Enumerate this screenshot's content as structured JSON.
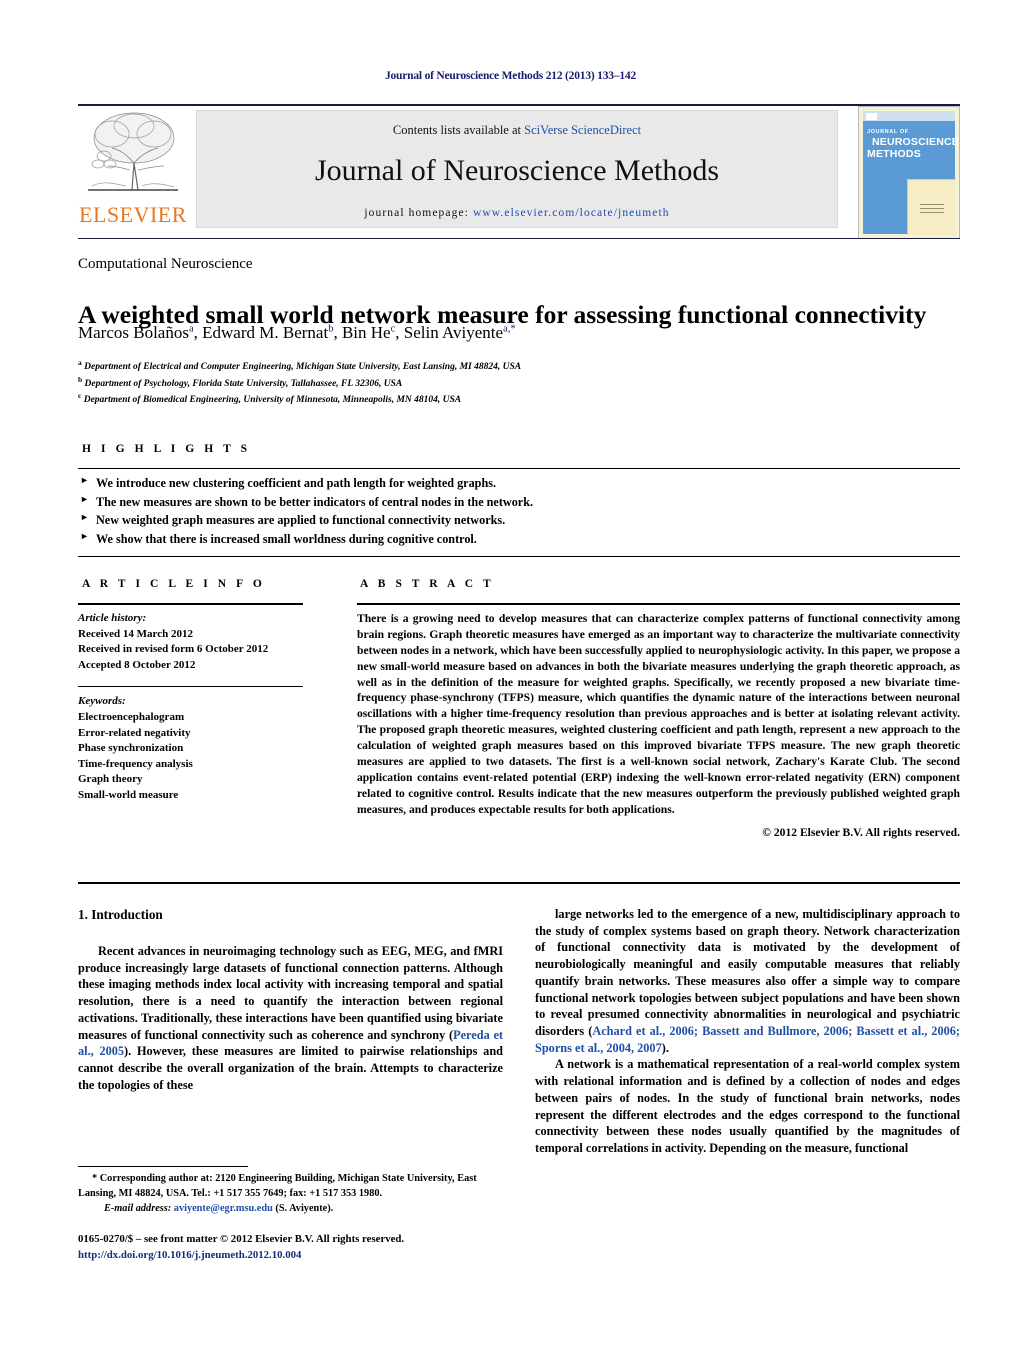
{
  "running_head": "Journal of Neuroscience Methods 212 (2013) 133–142",
  "masthead": {
    "publisher_logo_text": "ELSEVIER",
    "contents_prefix": "Contents lists available at ",
    "contents_link": "SciVerse ScienceDirect",
    "journal_title": "Journal of Neuroscience Methods",
    "homepage_prefix": "journal homepage: ",
    "homepage_url": "www.elsevier.com/locate/jneumeth",
    "cover": {
      "line1": "JOURNAL OF",
      "line2": "NEUROSCIENCE",
      "line3": "METHODS"
    }
  },
  "article": {
    "section_label": "Computational Neuroscience",
    "title": "A weighted small world network measure for assessing functional connectivity",
    "authors_html": "Marcos Bolaños<sup>a</sup>, Edward M. Bernat<sup>b</sup>, Bin He<sup>c</sup>, Selin Aviyente<sup>a,*</sup>",
    "affiliations": [
      "Department of Electrical and Computer Engineering, Michigan State University, East Lansing, MI 48824, USA",
      "Department of Psychology, Florida State University, Tallahassee, FL 32306, USA",
      "Department of Biomedical Engineering, University of Minnesota, Minneapolis, MN 48104, USA"
    ],
    "affiliation_markers": [
      "a",
      "b",
      "c"
    ]
  },
  "highlights": {
    "header": "H I G H L I G H T S",
    "bullet_glyph": "►",
    "items": [
      "We introduce new clustering coefficient and path length for weighted graphs.",
      "The new measures are shown to be better indicators of central nodes in the network.",
      "New weighted graph measures are applied to functional connectivity networks.",
      "We show that there is increased small worldness during cognitive control."
    ]
  },
  "article_info": {
    "header": "A R T I C L E    I N F O",
    "history_label": "Article history:",
    "history": [
      "Received 14 March 2012",
      "Received in revised form 6 October 2012",
      "Accepted 8 October 2012"
    ],
    "keywords_label": "Keywords:",
    "keywords": [
      "Electroencephalogram",
      "Error-related negativity",
      "Phase synchronization",
      "Time-frequency analysis",
      "Graph theory",
      "Small-world measure"
    ]
  },
  "abstract": {
    "header": "A B S T R A C T",
    "text": "There is a growing need to develop measures that can characterize complex patterns of functional connectivity among brain regions. Graph theoretic measures have emerged as an important way to characterize the multivariate connectivity between nodes in a network, which have been successfully applied to neurophysiologic activity. In this paper, we propose a new small-world measure based on advances in both the bivariate measures underlying the graph theoretic approach, as well as in the definition of the measure for weighted graphs. Specifically, we recently proposed a new bivariate time-frequency phase-synchrony (TFPS) measure, which quantifies the dynamic nature of the interactions between neuronal oscillations with a higher time-frequency resolution than previous approaches and is better at isolating relevant activity. The proposed graph theoretic measures, weighted clustering coefficient and path length, represent a new approach to the calculation of weighted graph measures based on this improved bivariate TFPS measure. The new graph theoretic measures are applied to two datasets. The first is a well-known social network, Zachary's Karate Club. The second application contains event-related potential (ERP) indexing the well-known error-related negativity (ERN) component related to cognitive control. Results indicate that the new measures outperform the previously published weighted graph measures, and produces expectable results for both applications.",
    "copyright": "© 2012 Elsevier B.V. All rights reserved."
  },
  "body": {
    "intro_heading": "1.  Introduction",
    "left_p1_a": "Recent advances in neuroimaging technology such as EEG, MEG, and fMRI produce increasingly large datasets of functional connection patterns. Although these imaging methods index local activity with increasing temporal and spatial resolution, there is a need to quantify the interaction between regional activations. Traditionally, these interactions have been quantified using bivariate measures of functional connectivity such as coherence and synchrony (",
    "left_cite1": "Pereda et al., 2005",
    "left_p1_b": "). However, these measures are limited to pairwise relationships and cannot describe the overall organization of the brain. Attempts to characterize the topologies of these",
    "right_p1_a": "large networks led to the emergence of a new, multidisciplinary approach to the study of complex systems based on graph theory. Network characterization of functional connectivity data is motivated by the development of neurobiologically meaningful and easily computable measures that reliably quantify brain networks. These measures also offer a simple way to compare functional network topologies between subject populations and have been shown to reveal presumed connectivity abnormalities in neurological and psychiatric disorders (",
    "right_cite1": "Achard et al., 2006; Bassett and Bullmore, 2006; Bassett et al., 2006; Sporns et al., 2004, 2007",
    "right_p1_b": ").",
    "right_p2": "A network is a mathematical representation of a real-world complex system with relational information and is defined by a collection of nodes and edges between pairs of nodes. In the study of functional brain networks, nodes represent the different electrodes and the edges correspond to the functional connectivity between these nodes usually quantified by the magnitudes of temporal correlations in activity. Depending on the measure, functional"
  },
  "footnote": {
    "marker": "*",
    "corresponding": " Corresponding author at: 2120 Engineering Building, Michigan State University, East Lansing, MI 48824, USA. Tel.: +1 517 355 7649; fax: +1 517 353 1980.",
    "email_label": "E-mail address:",
    "email": "aviyente@egr.msu.edu",
    "email_suffix": " (S. Aviyente)."
  },
  "imprint": {
    "line1": "0165-0270/$ – see front matter © 2012 Elsevier B.V. All rights reserved.",
    "doi": "http://dx.doi.org/10.1016/j.jneumeth.2012.10.004"
  }
}
